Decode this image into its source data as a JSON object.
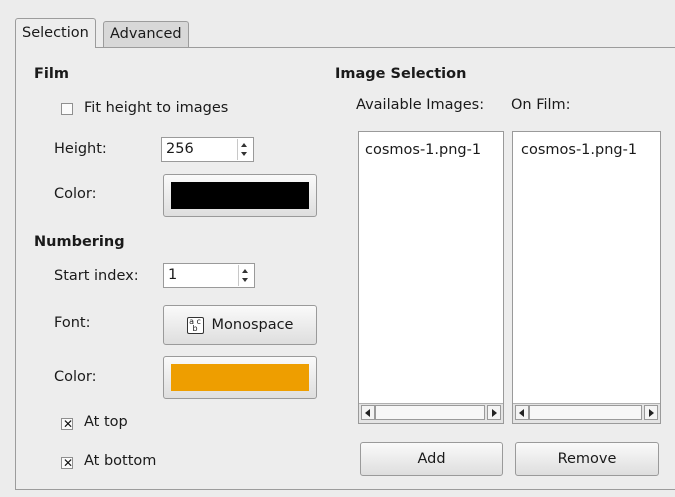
{
  "tabs": [
    {
      "label": "Selection",
      "active": true
    },
    {
      "label": "Advanced",
      "active": false
    }
  ],
  "film": {
    "heading": "Film",
    "fit_height": {
      "label": "Fit height to images",
      "checked": false
    },
    "height": {
      "label": "Height:",
      "value": "256"
    },
    "color": {
      "label": "Color:",
      "value": "#000000"
    }
  },
  "numbering": {
    "heading": "Numbering",
    "start_index": {
      "label": "Start index:",
      "value": "1"
    },
    "font": {
      "label": "Font:",
      "value": "Monospace"
    },
    "color": {
      "label": "Color:",
      "value": "#ee9e00"
    },
    "at_top": {
      "label": "At top",
      "checked": true
    },
    "at_bottom": {
      "label": "At bottom",
      "checked": true
    }
  },
  "image_selection": {
    "heading": "Image Selection",
    "available_label": "Available Images:",
    "on_film_label": "On Film:",
    "available_items": [
      "cosmos-1.png-1"
    ],
    "on_film_items": [
      "cosmos-1.png-1"
    ],
    "add_label": "Add",
    "remove_label": "Remove"
  }
}
